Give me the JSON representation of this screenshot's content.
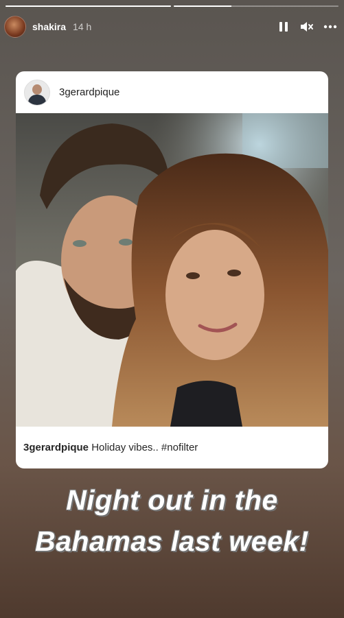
{
  "story": {
    "username": "shakira",
    "time": "14 h",
    "progress": [
      1.0,
      0.35
    ]
  },
  "icons": {
    "pause": "pause-icon",
    "mute": "speaker-muted-icon",
    "more": "more-options-icon"
  },
  "post": {
    "username": "3gerardpique",
    "caption_user": "3gerardpique",
    "caption_text": "Holiday vibes.. #nofilter"
  },
  "overlay": {
    "line1": "Night out in the",
    "line2": "Bahamas last week!"
  }
}
